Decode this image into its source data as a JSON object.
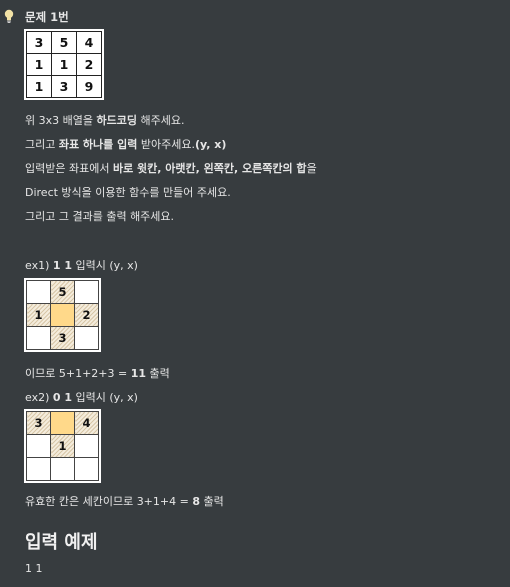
{
  "problem": {
    "title": "문제 1번",
    "grid": [
      [
        "3",
        "5",
        "4"
      ],
      [
        "1",
        "1",
        "2"
      ],
      [
        "1",
        "3",
        "9"
      ]
    ],
    "lines": [
      {
        "parts": [
          {
            "t": "위 3x3 배열을 ",
            "b": false
          },
          {
            "t": "하드코딩",
            "b": true
          },
          {
            "t": " 해주세요.",
            "b": false
          }
        ]
      },
      {
        "parts": [
          {
            "t": "그리고 ",
            "b": false
          },
          {
            "t": "좌표 하나를 입력",
            "b": true
          },
          {
            "t": " 받아주세요.",
            "b": false
          },
          {
            "t": "(y, x)",
            "b": true
          }
        ]
      },
      {
        "parts": [
          {
            "t": "입력받은 좌표에서 ",
            "b": false
          },
          {
            "t": "바로 윗칸, 아랫칸, 왼쪽칸, 오른쪽칸의 합",
            "b": true
          },
          {
            "t": "을",
            "b": false
          }
        ]
      },
      {
        "parts": [
          {
            "t": "Direct 방식을 이용한 함수를 만들어 주세요.",
            "b": false
          }
        ]
      },
      {
        "parts": [
          {
            "t": "그리고 그 결과를 출력 해주세요.",
            "b": false
          }
        ]
      }
    ]
  },
  "example1": {
    "label_prefix": "ex1) ",
    "label_bold": "1 1",
    "label_suffix": " 입력시 (y, x)",
    "cells": [
      [
        "",
        "5",
        ""
      ],
      [
        "1",
        "",
        "2"
      ],
      [
        "",
        "3",
        ""
      ]
    ],
    "result_prefix": "이므로 5+1+2+3 = ",
    "result_bold": "11",
    "result_suffix": " 출력"
  },
  "example2": {
    "label_prefix": "ex2) ",
    "label_bold": "0 1",
    "label_suffix": " 입력시 (y, x)",
    "cells": [
      [
        "3",
        "",
        "4"
      ],
      [
        "",
        "1",
        ""
      ],
      [
        "",
        "",
        ""
      ]
    ],
    "result_prefix": "유효한 칸은 세칸이므로 3+1+4 = ",
    "result_bold": "8",
    "result_suffix": " 출력"
  },
  "input_example": {
    "heading": "입력 예제",
    "value": "1 1"
  },
  "colors": {
    "background": "#373c3f",
    "highlight_center": "#ffd98a",
    "hatch": "#d8c7a8"
  },
  "icons": {
    "bulb": "lightbulb-icon"
  }
}
